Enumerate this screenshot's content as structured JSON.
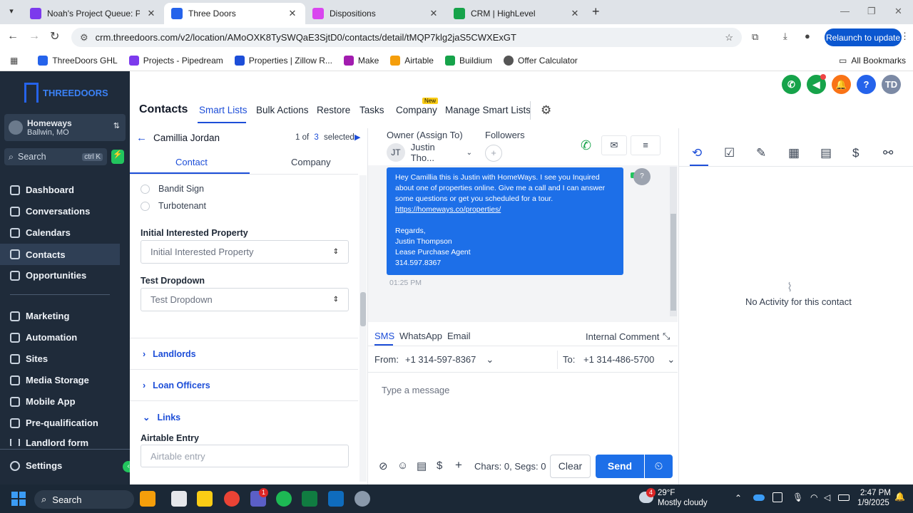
{
  "browser": {
    "tabs": [
      {
        "title": "Noah's Project Queue: Projects",
        "active": false,
        "color": "#7c3aed"
      },
      {
        "title": "Three Doors",
        "active": true,
        "color": "#2563eb"
      },
      {
        "title": "Dispositions",
        "active": false,
        "color": "#d946ef"
      },
      {
        "title": "CRM | HighLevel",
        "active": false,
        "color": "#16a34a"
      }
    ],
    "url": "crm.threedoors.com/v2/location/AMoOXK8TySWQaE3SjtD0/contacts/detail/tMQP7klg2jaS5CWXExGT",
    "relaunch": "Relaunch to update",
    "bookmarks": [
      "ThreeDoors GHL",
      "Projects - Pipedream",
      "Properties | Zillow R...",
      "Make",
      "Airtable",
      "Buildium",
      "Offer Calculator"
    ],
    "all_bookmarks": "All Bookmarks"
  },
  "sidebar": {
    "logo": "THREEDOORS",
    "account_name": "Homeways",
    "account_location": "Ballwin, MO",
    "search": "Search",
    "search_shortcut": "ctrl K",
    "items": [
      {
        "label": "Dashboard",
        "icon": "dashboard-icon"
      },
      {
        "label": "Conversations",
        "icon": "chat-icon"
      },
      {
        "label": "Calendars",
        "icon": "calendar-icon"
      },
      {
        "label": "Contacts",
        "icon": "contacts-icon",
        "active": true
      },
      {
        "label": "Opportunities",
        "icon": "opportunities-icon"
      },
      {
        "label": "Marketing",
        "icon": "marketing-icon"
      },
      {
        "label": "Automation",
        "icon": "automation-icon"
      },
      {
        "label": "Sites",
        "icon": "sites-icon"
      },
      {
        "label": "Media Storage",
        "icon": "media-icon"
      },
      {
        "label": "Mobile App",
        "icon": "mobile-icon"
      },
      {
        "label": "Pre-qualification",
        "icon": "prequal-icon"
      },
      {
        "label": "Landlord form",
        "icon": "form-icon"
      }
    ],
    "settings": "Settings"
  },
  "header": {
    "title": "Contacts",
    "tabs": [
      "Smart Lists",
      "Bulk Actions",
      "Restore",
      "Tasks",
      "Company",
      "Manage Smart Lists"
    ],
    "new_badge": "New",
    "user_initials": "TD"
  },
  "contact": {
    "name": "Camillia Jordan",
    "pager_current": "1 of",
    "pager_total": "3",
    "pager_suffix": "selected",
    "tab_contact": "Contact",
    "tab_company": "Company",
    "options": [
      "Bandit Sign",
      "Turbotenant"
    ],
    "fields": [
      {
        "label": "Initial Interested Property",
        "placeholder": "Initial Interested Property"
      },
      {
        "label": "Test Dropdown",
        "placeholder": "Test Dropdown"
      }
    ],
    "sections": [
      "Landlords",
      "Loan Officers",
      "Links"
    ],
    "airtable_label": "Airtable Entry",
    "airtable_placeholder": "Airtable entry"
  },
  "conversation": {
    "owner_label": "Owner (Assign To)",
    "owner_initials": "JT",
    "owner_name": "Justin Tho...",
    "followers_label": "Followers",
    "message_lines": [
      "Hey Camillia this is Justin with HomeWays. I see you Inquired",
      "about one of properties online. Give me a call and I can answer",
      "some questions or get you scheduled for a tour.",
      "https://homeways.co/properties/",
      "",
      "Regards,",
      "Justin Thompson",
      "Lease Purchase Agent",
      "314.597.8367"
    ],
    "message_time": "01:25 PM",
    "channels": [
      "SMS",
      "WhatsApp",
      "Email"
    ],
    "internal_comment": "Internal Comment",
    "from_label": "From:",
    "from_number": "+1 314-597-8367",
    "to_label": "To:",
    "to_number": "+1 314-486-5700",
    "placeholder": "Type a message",
    "counter": "Chars: 0, Segs: 0",
    "clear": "Clear",
    "send": "Send"
  },
  "activity": {
    "empty": "No Activity for this contact"
  },
  "taskbar": {
    "search": "Search",
    "weather_temp": "29°F",
    "weather_desc": "Mostly cloudy",
    "weather_badge": "4",
    "time": "2:47 PM",
    "date": "1/9/2025",
    "teams_badge": "1"
  }
}
